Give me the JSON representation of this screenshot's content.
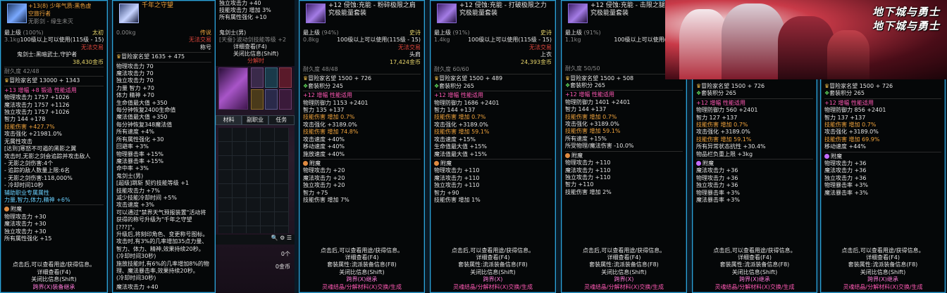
{
  "panel1": {
    "title_a": "+13(8) 少年气质:黑色虚",
    "title_b": "空旅行者",
    "sub": "无影剑 - 缘生未灭",
    "grade": "最上级",
    "grade_pct": "(100%)",
    "tier": "太初",
    "weight": "3.1kg",
    "req": "100级以上可以使用(115级 - 15)",
    "untradeable": "无法交易",
    "classes": "鬼剑士:黑暗武士,守护者",
    "price": "38,430金币",
    "dur": "耐久度 42/48",
    "fame": "冒险家名望",
    "fame_val": "13000 + 1343",
    "lines": [
      "+13 增幅 +8 锻造 性能适用",
      "物理攻击力 1757 +1026",
      "魔法攻击力 1757 +1126",
      "独立攻击力 1757 +1026",
      "智力 144 +178",
      "技能伤害 +427.7%",
      "攻击强化 +21981.0%",
      "无属性攻击",
      "[达到]寒怒不可遏的黑影之翼",
      "攻击时,无影之剑会追踪并攻击敌人",
      "- 无影之剑伤害:4个",
      "- 追踪的敌人数量上限:6名",
      "- 无影之剑伤害:118,000%",
      "- 冷却时间10秒",
      "辅助职业专属属性",
      "力量,智力,体力,精神 +6%"
    ],
    "enchant": "附魔",
    "ench_lines": [
      "物理攻击力 +30",
      "魔法攻击力 +30",
      "独立攻击力 +30",
      "所有属性强化 +15"
    ],
    "foot1": "点击后,可以查看用途/获得信息。",
    "foot2": "详细查看(F4)",
    "foot3": "关闭比信息(Shift)",
    "foot4": "跨界(X)装备继承"
  },
  "panel2": {
    "title": "千年之守望",
    "weight": "0.00kg",
    "grade": "传说",
    "untradeable": "无法交易",
    "note": "称号",
    "fame": "冒险家名望",
    "fame_val": "1635 + 475",
    "lines": [
      "物理攻击力 70",
      "魔法攻击力 70",
      "独立攻击力 70",
      "力量 智力 +70",
      "体力 精神 +70",
      "生命值最大值 +350",
      "每分钟恢复2400生命值",
      "魔法值最大值 +350",
      "每分钟恢复348魔法值",
      "所有速度 +4%",
      "所有属性强化 +30",
      "回避率 +3%",
      "物理暴击率 +15%",
      "魔法暴击率 +15%",
      "命中率 +3%",
      "鬼剑士(男)",
      "[超级]跳斩 契约技能等级 +1",
      "技能攻击力 +7%",
      "减少技能冷却时间 +5%",
      "攻击速度 +3%",
      "可以通过\"禁界天气预报装置\"活动将获得的称号升级为\"千年之守望[???]\"。",
      "升级后,将刻印角色、变更称号图标。",
      "攻击时,有3%的几率增加35点力量、智力、体力、精神,效果持续20秒。",
      "(冷却时间30秒)",
      "施放技能时,有6%的几率增加8%的物理、魔法暴击率,效果持续20秒。",
      "(冷却时间30秒)"
    ],
    "last": "魔法攻击力 +40"
  },
  "midpanel": {
    "l1": "独立攻击力 +40",
    "l2": "技能攻击力 增加 3%",
    "l3": "所有属性强化 +10",
    "class": "鬼剑士(男)",
    "tree": "[天蚕]·波动剑技能等级 +2",
    "d1": "详细查看(F4)",
    "d2": "关闭比信息(Shift)",
    "d3": "分解时",
    "tabs": [
      "材料",
      "副职业",
      "任务"
    ],
    "count": "0个",
    "gold": "0金币"
  },
  "panel3": {
    "title": "+12 侵蚀:充能 - 粉碎极限之肩",
    "set": "究极能量套装",
    "grade": "最上级",
    "grade_pct": "(94%)",
    "tier": "史诗",
    "weight": "0.8kg",
    "req": "100级以上可以使用(115级 - 15)",
    "untradeable": "无法交易",
    "slot": "头肩",
    "price": "17,424金币",
    "dur": "耐久度 48/48",
    "fame": "冒险家名望",
    "fame_val": "1500 + 726",
    "setpt": "套装积分 245",
    "lines": [
      "+12 增幅 性能适用",
      "物理防御力 1153 +2401",
      "智力 135 +137",
      "技能伤害 增加 0.7%",
      "攻击强化 +3189.0%",
      "技能伤害 增加 74.8%",
      "攻击速度 +40%",
      "移动速度 +40%",
      "施放速度 +40%"
    ],
    "enchant": "附魔",
    "ench_lines": [
      "物理攻击力 +20",
      "魔法攻击力 +20",
      "独立攻击力 +20",
      "智力 +75",
      "技能伤害 增加 7%"
    ],
    "foot1": "点击后,可以查看用途/获得信息。",
    "foot2": "详细查看(F4)",
    "foot3": "套装属性:流派装备信息(F8)",
    "foot4": "关闭比信息(Shift)",
    "foot5": "跨界(X)继承",
    "foot6": "灵魂结晶/分解材料(X)交换/生成"
  },
  "panel4": {
    "title": "+12 侵蚀:充能 - 打破极限之力",
    "set": "究极能量套装",
    "grade": "最上级",
    "grade_pct": "(91%)",
    "tier": "史诗",
    "weight": "1.4kg",
    "req": "100级以上可以使用(115级 - 15)",
    "untradeable": "无法交易",
    "slot": "上衣",
    "price": "24,393金币",
    "dur": "耐久度 60/60",
    "fame": "冒险家名望",
    "fame_val": "1500 + 489",
    "setpt": "套装积分 265",
    "lines": [
      "+12 增幅 性能适用",
      "物理防御力 1686 +2401",
      "智力 144 +137",
      "技能伤害 增加 0.7%",
      "攻击强化 +3189.0%",
      "技能伤害 增加 59.1%",
      "攻击速度 +15%",
      "生命值最大值 +15%",
      "魔法值最大值 +15%"
    ],
    "enchant": "附魔",
    "ench_lines": [
      "物理攻击力 +110",
      "魔法攻击力 +110",
      "独立攻击力 +110",
      "智力 +90",
      "技能伤害 增加 1%"
    ],
    "foot1": "点击后,可以查看用途/获得信息。",
    "foot2": "详细查看(F4)",
    "foot3": "套装属性:流派装备信息(F8)",
    "foot4": "关闭比信息(Shift)",
    "foot5": "跨界(X)",
    "foot6": "灵魂结晶/分解材料(X)交换/生成"
  },
  "panel5": {
    "title": "+12 侵蚀:充能 - 击限之腿",
    "set": "究极能量套装",
    "grade": "最上级",
    "grade_pct": "(91%)",
    "weight": "1.1kg",
    "req": "100级以上可以使用(115级",
    "price": "20,9",
    "dur": "耐久度 50/50",
    "fame": "冒险家名望",
    "fame_val": "1500 + 508",
    "setpt": "套装积分 265",
    "lines": [
      "+12 增幅 性能适用",
      "物理防御力 1401 +2401",
      "智力 144 +137",
      "技能伤害 增加 0.7%",
      "攻击强化 +3189.0%",
      "技能伤害 增加 59.1%",
      "所有速度 +15%",
      "所受物理/魔法伤害 -10.0%"
    ],
    "enchant": "附魔",
    "ench_lines": [
      "物理攻击力 +110",
      "魔法攻击力 +110",
      "独立攻击力 +110",
      "智力 +110",
      "技能伤害 增加 2%"
    ],
    "foot1": "点击后,可以查看用途/获得信息。",
    "foot2": "详细查看(F4)",
    "foot3": "套装属性:流派装备信息(F8)",
    "foot4": "关闭比信息(Shift)",
    "foot5": "跨界(X)",
    "foot6": "灵魂结晶/分解材料(X)交换/生成"
  },
  "panel6": {
    "fame": "冒险家名望",
    "fame_val": "1500 + 726",
    "setpt": "套装积分 265",
    "lines": [
      "+12 增幅 性能适用",
      "物理防御力 560 +2401",
      "智力 127 +137",
      "技能伤害 增加 0.7%",
      "攻击强化 +3189.0%",
      "技能伤害 增加 59.1%",
      "所有异常状态抗性 +30.4%",
      "物品栏负重上限 +3kg"
    ],
    "enchant": "附魔",
    "ench_lines": [
      "魔法攻击力 +36",
      "物理攻击力 +36",
      "独立攻击力 +36",
      "物理暴击率 +3%",
      "魔法暴击率 +3%"
    ],
    "foot1": "点击后,可以查看用途/获得信息。",
    "foot2": "详细查看(F4)",
    "foot3": "套装属性:流派装备信息(F8)",
    "foot4": "关闭比信息(Shift)",
    "foot5": "跨界(X)继承",
    "foot6": "灵魂结晶/分解材料(X)交换/生成"
  },
  "panel7": {
    "fame": "冒险家名望",
    "fame_val": "1500 + 726",
    "setpt": "套装积分 265",
    "lines": [
      "+12 增幅 性能适用",
      "物理防御力 856 +2401",
      "智力 137 +137",
      "技能伤害 增加 0.7%",
      "攻击强化 +3189.0%",
      "技能伤害 增加 69.9%",
      "移动速度 +44%"
    ],
    "enchant": "附魔",
    "ench_lines": [
      "物理攻击力 +36",
      "魔法攻击力 +36",
      "独立攻击力 +36",
      "物理暴击率 +3%",
      "魔法暴击率 +3%"
    ],
    "foot1": "点击后,可以查看用途/获得信息。",
    "foot2": "详细查看(F4)",
    "foot3": "套装属性:流派装备信息(F8)",
    "foot4": "关闭比信息(Shift)",
    "foot5": "跨界(X)继承",
    "foot6": "灵魂结晶/分解材料(X)交换/生成"
  },
  "banner": {
    "logo1": "地下城与勇士",
    "logo2": "地下城与勇士"
  }
}
